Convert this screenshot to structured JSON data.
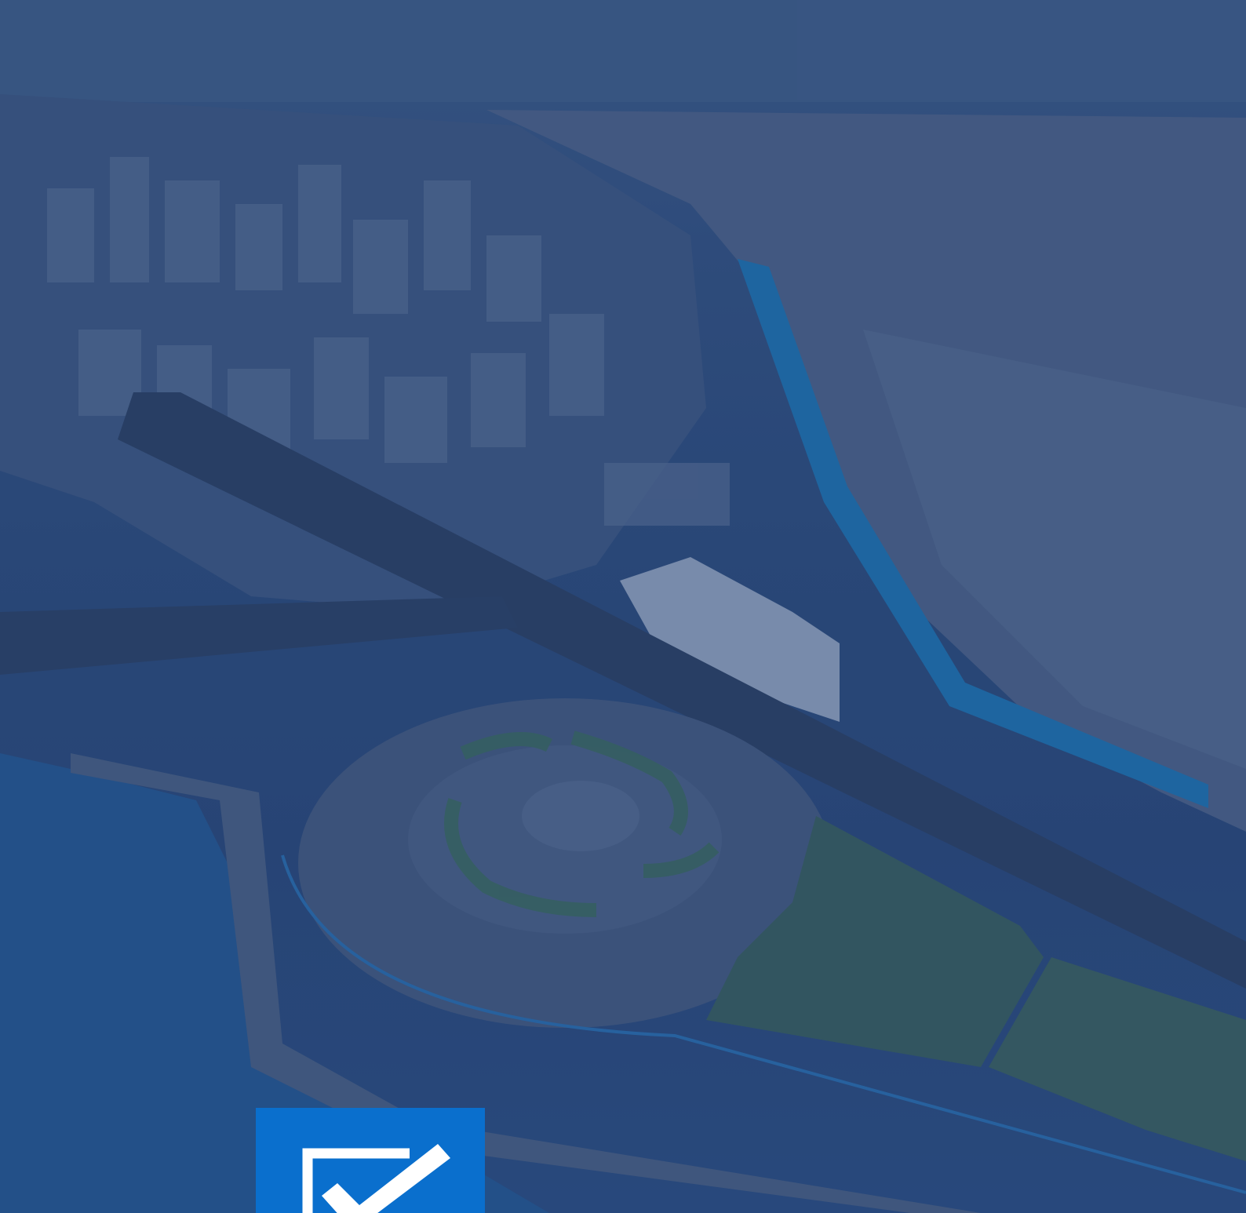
{
  "hero": {
    "image_subject": "",
    "overlay_color": "#204278"
  },
  "badge": {
    "icon": "checkbox-check-icon",
    "color": "#0a6fcd"
  }
}
